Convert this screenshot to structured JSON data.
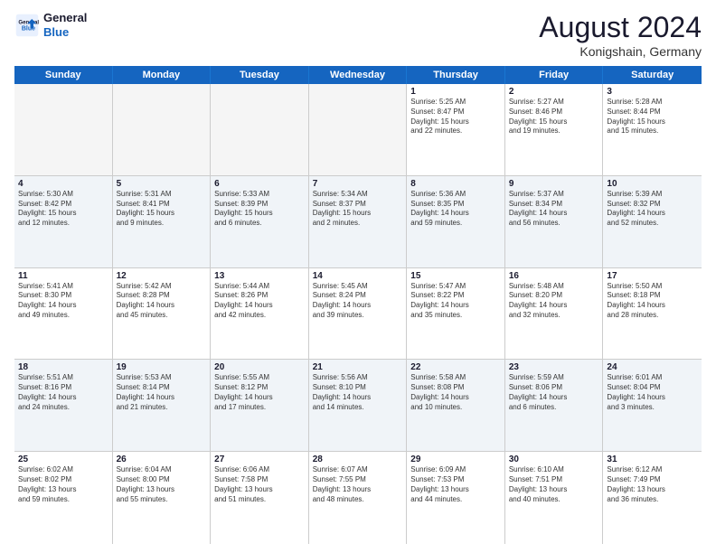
{
  "header": {
    "logo_line1": "General",
    "logo_line2": "Blue",
    "month_title": "August 2024",
    "location": "Konigshain, Germany"
  },
  "days_of_week": [
    "Sunday",
    "Monday",
    "Tuesday",
    "Wednesday",
    "Thursday",
    "Friday",
    "Saturday"
  ],
  "weeks": [
    [
      {
        "day": "",
        "empty": true
      },
      {
        "day": "",
        "empty": true
      },
      {
        "day": "",
        "empty": true
      },
      {
        "day": "",
        "empty": true
      },
      {
        "day": "1",
        "line1": "Sunrise: 5:25 AM",
        "line2": "Sunset: 8:47 PM",
        "line3": "Daylight: 15 hours",
        "line4": "and 22 minutes."
      },
      {
        "day": "2",
        "line1": "Sunrise: 5:27 AM",
        "line2": "Sunset: 8:46 PM",
        "line3": "Daylight: 15 hours",
        "line4": "and 19 minutes."
      },
      {
        "day": "3",
        "line1": "Sunrise: 5:28 AM",
        "line2": "Sunset: 8:44 PM",
        "line3": "Daylight: 15 hours",
        "line4": "and 15 minutes."
      }
    ],
    [
      {
        "day": "4",
        "line1": "Sunrise: 5:30 AM",
        "line2": "Sunset: 8:42 PM",
        "line3": "Daylight: 15 hours",
        "line4": "and 12 minutes."
      },
      {
        "day": "5",
        "line1": "Sunrise: 5:31 AM",
        "line2": "Sunset: 8:41 PM",
        "line3": "Daylight: 15 hours",
        "line4": "and 9 minutes."
      },
      {
        "day": "6",
        "line1": "Sunrise: 5:33 AM",
        "line2": "Sunset: 8:39 PM",
        "line3": "Daylight: 15 hours",
        "line4": "and 6 minutes."
      },
      {
        "day": "7",
        "line1": "Sunrise: 5:34 AM",
        "line2": "Sunset: 8:37 PM",
        "line3": "Daylight: 15 hours",
        "line4": "and 2 minutes."
      },
      {
        "day": "8",
        "line1": "Sunrise: 5:36 AM",
        "line2": "Sunset: 8:35 PM",
        "line3": "Daylight: 14 hours",
        "line4": "and 59 minutes."
      },
      {
        "day": "9",
        "line1": "Sunrise: 5:37 AM",
        "line2": "Sunset: 8:34 PM",
        "line3": "Daylight: 14 hours",
        "line4": "and 56 minutes."
      },
      {
        "day": "10",
        "line1": "Sunrise: 5:39 AM",
        "line2": "Sunset: 8:32 PM",
        "line3": "Daylight: 14 hours",
        "line4": "and 52 minutes."
      }
    ],
    [
      {
        "day": "11",
        "line1": "Sunrise: 5:41 AM",
        "line2": "Sunset: 8:30 PM",
        "line3": "Daylight: 14 hours",
        "line4": "and 49 minutes."
      },
      {
        "day": "12",
        "line1": "Sunrise: 5:42 AM",
        "line2": "Sunset: 8:28 PM",
        "line3": "Daylight: 14 hours",
        "line4": "and 45 minutes."
      },
      {
        "day": "13",
        "line1": "Sunrise: 5:44 AM",
        "line2": "Sunset: 8:26 PM",
        "line3": "Daylight: 14 hours",
        "line4": "and 42 minutes."
      },
      {
        "day": "14",
        "line1": "Sunrise: 5:45 AM",
        "line2": "Sunset: 8:24 PM",
        "line3": "Daylight: 14 hours",
        "line4": "and 39 minutes."
      },
      {
        "day": "15",
        "line1": "Sunrise: 5:47 AM",
        "line2": "Sunset: 8:22 PM",
        "line3": "Daylight: 14 hours",
        "line4": "and 35 minutes."
      },
      {
        "day": "16",
        "line1": "Sunrise: 5:48 AM",
        "line2": "Sunset: 8:20 PM",
        "line3": "Daylight: 14 hours",
        "line4": "and 32 minutes."
      },
      {
        "day": "17",
        "line1": "Sunrise: 5:50 AM",
        "line2": "Sunset: 8:18 PM",
        "line3": "Daylight: 14 hours",
        "line4": "and 28 minutes."
      }
    ],
    [
      {
        "day": "18",
        "line1": "Sunrise: 5:51 AM",
        "line2": "Sunset: 8:16 PM",
        "line3": "Daylight: 14 hours",
        "line4": "and 24 minutes."
      },
      {
        "day": "19",
        "line1": "Sunrise: 5:53 AM",
        "line2": "Sunset: 8:14 PM",
        "line3": "Daylight: 14 hours",
        "line4": "and 21 minutes."
      },
      {
        "day": "20",
        "line1": "Sunrise: 5:55 AM",
        "line2": "Sunset: 8:12 PM",
        "line3": "Daylight: 14 hours",
        "line4": "and 17 minutes."
      },
      {
        "day": "21",
        "line1": "Sunrise: 5:56 AM",
        "line2": "Sunset: 8:10 PM",
        "line3": "Daylight: 14 hours",
        "line4": "and 14 minutes."
      },
      {
        "day": "22",
        "line1": "Sunrise: 5:58 AM",
        "line2": "Sunset: 8:08 PM",
        "line3": "Daylight: 14 hours",
        "line4": "and 10 minutes."
      },
      {
        "day": "23",
        "line1": "Sunrise: 5:59 AM",
        "line2": "Sunset: 8:06 PM",
        "line3": "Daylight: 14 hours",
        "line4": "and 6 minutes."
      },
      {
        "day": "24",
        "line1": "Sunrise: 6:01 AM",
        "line2": "Sunset: 8:04 PM",
        "line3": "Daylight: 14 hours",
        "line4": "and 3 minutes."
      }
    ],
    [
      {
        "day": "25",
        "line1": "Sunrise: 6:02 AM",
        "line2": "Sunset: 8:02 PM",
        "line3": "Daylight: 13 hours",
        "line4": "and 59 minutes."
      },
      {
        "day": "26",
        "line1": "Sunrise: 6:04 AM",
        "line2": "Sunset: 8:00 PM",
        "line3": "Daylight: 13 hours",
        "line4": "and 55 minutes."
      },
      {
        "day": "27",
        "line1": "Sunrise: 6:06 AM",
        "line2": "Sunset: 7:58 PM",
        "line3": "Daylight: 13 hours",
        "line4": "and 51 minutes."
      },
      {
        "day": "28",
        "line1": "Sunrise: 6:07 AM",
        "line2": "Sunset: 7:55 PM",
        "line3": "Daylight: 13 hours",
        "line4": "and 48 minutes."
      },
      {
        "day": "29",
        "line1": "Sunrise: 6:09 AM",
        "line2": "Sunset: 7:53 PM",
        "line3": "Daylight: 13 hours",
        "line4": "and 44 minutes."
      },
      {
        "day": "30",
        "line1": "Sunrise: 6:10 AM",
        "line2": "Sunset: 7:51 PM",
        "line3": "Daylight: 13 hours",
        "line4": "and 40 minutes."
      },
      {
        "day": "31",
        "line1": "Sunrise: 6:12 AM",
        "line2": "Sunset: 7:49 PM",
        "line3": "Daylight: 13 hours",
        "line4": "and 36 minutes."
      }
    ]
  ]
}
